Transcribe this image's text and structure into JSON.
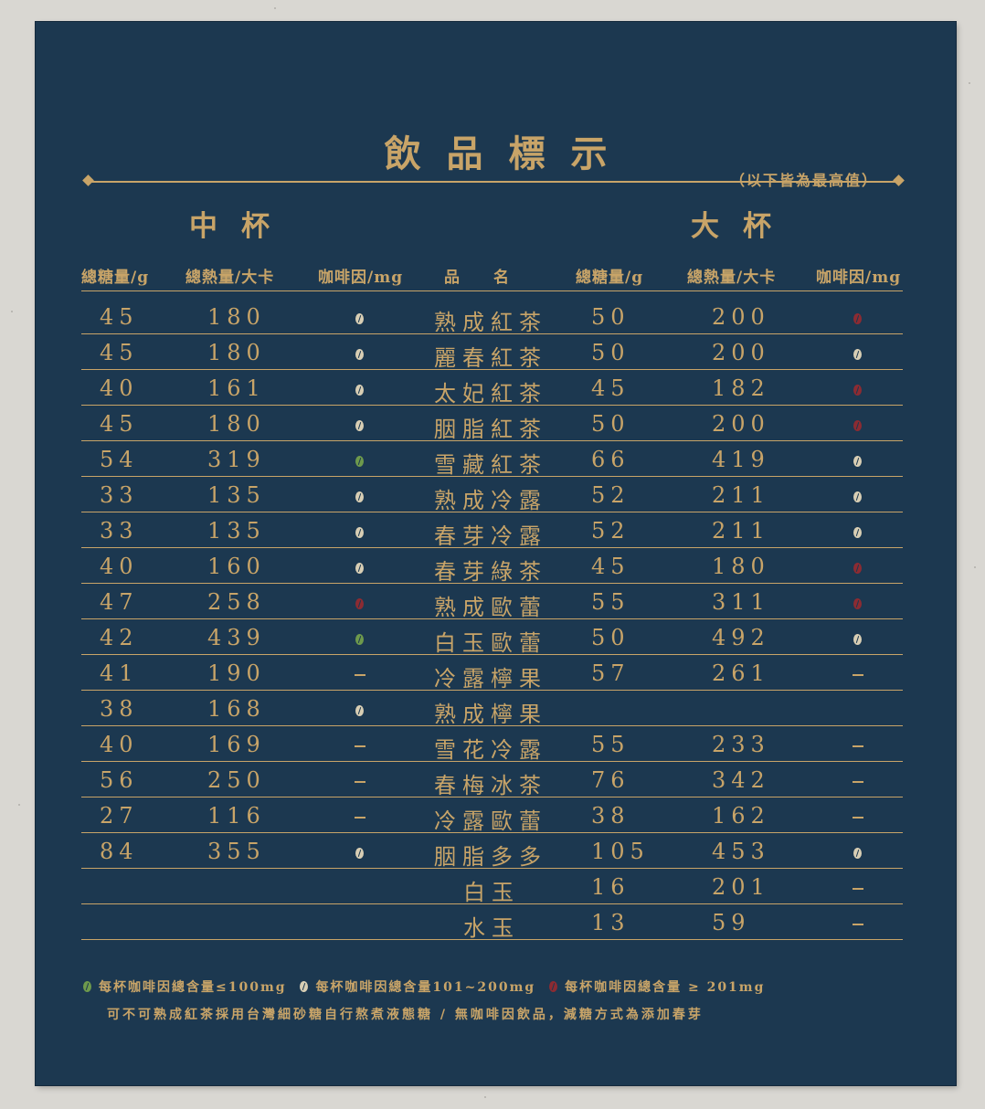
{
  "title": "飲品標示",
  "note": "（以下皆為最高值）",
  "sections": {
    "medium": "中杯",
    "large": "大杯"
  },
  "headers": {
    "medium_sugar": "總糖量/g",
    "medium_calories": "總熱量/大卡",
    "medium_caffeine": "咖啡因/mg",
    "name": "品　　名",
    "large_sugar": "總糖量/g",
    "large_calories": "總熱量/大卡",
    "large_caffeine": "咖啡因/mg"
  },
  "caffeine_colors": {
    "low": "#6e9a4c",
    "mid": "#d8ceb4",
    "high": "#8c2b32"
  },
  "rows": [
    {
      "name": "熟成紅茶",
      "m_sugar": "45",
      "m_cal": "180",
      "m_caf": "mid",
      "l_sugar": "50",
      "l_cal": "200",
      "l_caf": "high"
    },
    {
      "name": "麗春紅茶",
      "m_sugar": "45",
      "m_cal": "180",
      "m_caf": "mid",
      "l_sugar": "50",
      "l_cal": "200",
      "l_caf": "mid"
    },
    {
      "name": "太妃紅茶",
      "m_sugar": "40",
      "m_cal": "161",
      "m_caf": "mid",
      "l_sugar": "45",
      "l_cal": "182",
      "l_caf": "high"
    },
    {
      "name": "胭脂紅茶",
      "m_sugar": "45",
      "m_cal": "180",
      "m_caf": "mid",
      "l_sugar": "50",
      "l_cal": "200",
      "l_caf": "high"
    },
    {
      "name": "雪藏紅茶",
      "m_sugar": "54",
      "m_cal": "319",
      "m_caf": "low",
      "l_sugar": "66",
      "l_cal": "419",
      "l_caf": "mid"
    },
    {
      "name": "熟成冷露",
      "m_sugar": "33",
      "m_cal": "135",
      "m_caf": "mid",
      "l_sugar": "52",
      "l_cal": "211",
      "l_caf": "mid"
    },
    {
      "name": "春芽冷露",
      "m_sugar": "33",
      "m_cal": "135",
      "m_caf": "mid",
      "l_sugar": "52",
      "l_cal": "211",
      "l_caf": "mid"
    },
    {
      "name": "春芽綠茶",
      "m_sugar": "40",
      "m_cal": "160",
      "m_caf": "mid",
      "l_sugar": "45",
      "l_cal": "180",
      "l_caf": "high"
    },
    {
      "name": "熟成歐蕾",
      "m_sugar": "47",
      "m_cal": "258",
      "m_caf": "high",
      "l_sugar": "55",
      "l_cal": "311",
      "l_caf": "high"
    },
    {
      "name": "白玉歐蕾",
      "m_sugar": "42",
      "m_cal": "439",
      "m_caf": "low",
      "l_sugar": "50",
      "l_cal": "492",
      "l_caf": "mid"
    },
    {
      "name": "冷露檸果",
      "m_sugar": "41",
      "m_cal": "190",
      "m_caf": "none",
      "l_sugar": "57",
      "l_cal": "261",
      "l_caf": "none"
    },
    {
      "name": "熟成檸果",
      "m_sugar": "38",
      "m_cal": "168",
      "m_caf": "mid",
      "l_sugar": "",
      "l_cal": "",
      "l_caf": "blank"
    },
    {
      "name": "雪花冷露",
      "m_sugar": "40",
      "m_cal": "169",
      "m_caf": "none",
      "l_sugar": "55",
      "l_cal": "233",
      "l_caf": "none"
    },
    {
      "name": "春梅冰茶",
      "m_sugar": "56",
      "m_cal": "250",
      "m_caf": "none",
      "l_sugar": "76",
      "l_cal": "342",
      "l_caf": "none"
    },
    {
      "name": "冷露歐蕾",
      "m_sugar": "27",
      "m_cal": "116",
      "m_caf": "none",
      "l_sugar": "38",
      "l_cal": "162",
      "l_caf": "none"
    },
    {
      "name": "胭脂多多",
      "m_sugar": "84",
      "m_cal": "355",
      "m_caf": "mid",
      "l_sugar": "105",
      "l_cal": "453",
      "l_caf": "mid"
    },
    {
      "name": "白玉",
      "m_sugar": "",
      "m_cal": "",
      "m_caf": "blank",
      "l_sugar": "16",
      "l_cal": "201",
      "l_caf": "none",
      "indent": true
    },
    {
      "name": "水玉",
      "m_sugar": "",
      "m_cal": "",
      "m_caf": "blank",
      "l_sugar": "13",
      "l_cal": "59",
      "l_caf": "none",
      "indent": true
    }
  ],
  "legend": [
    {
      "level": "low",
      "text": "每杯咖啡因總含量≤100mg"
    },
    {
      "level": "mid",
      "text": "每杯咖啡因總含量101~200mg"
    },
    {
      "level": "high",
      "text": "每杯咖啡因總含量 ≥ 201mg"
    }
  ],
  "footnote": "可不可熟成紅茶採用台灣細砂糖自行熬煮液態糖 / 無咖啡因飲品，減糖方式為添加春芽"
}
